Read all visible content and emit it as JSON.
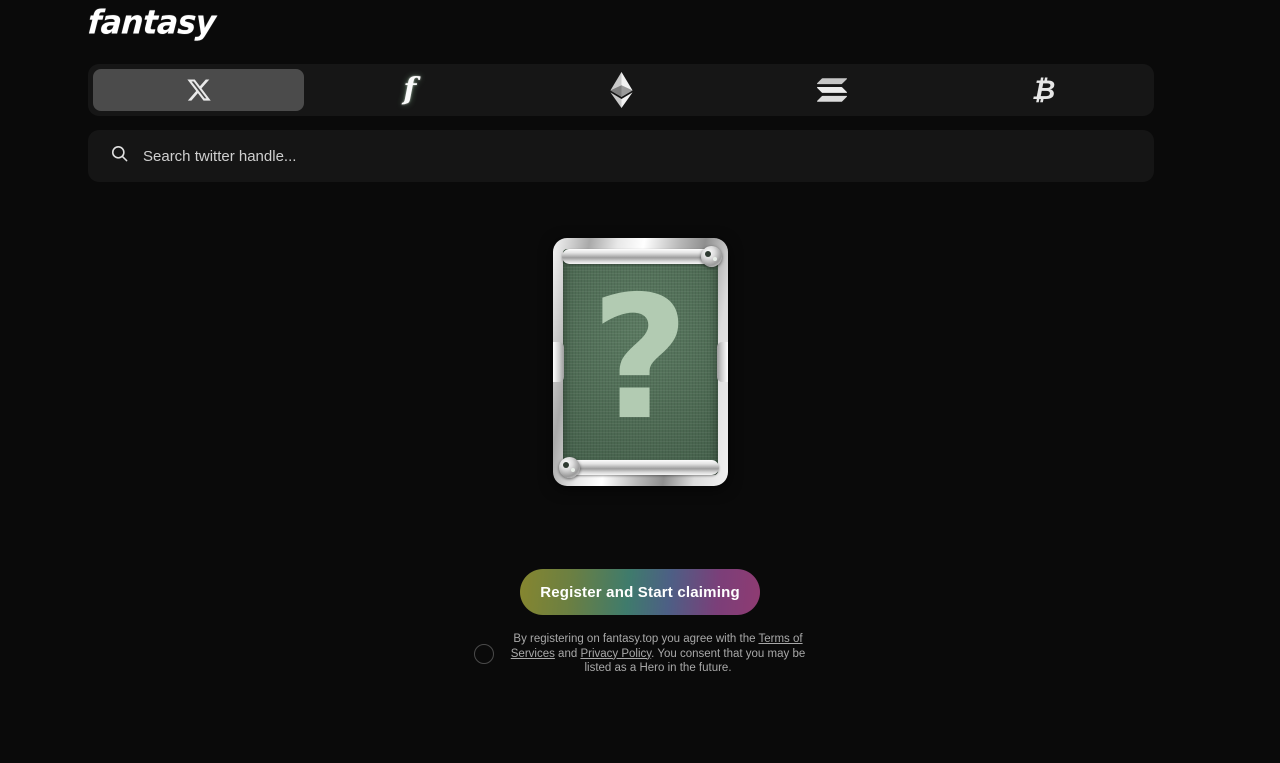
{
  "brand": {
    "logo_text": "fantasy"
  },
  "tabs": [
    {
      "id": "x",
      "icon": "x-twitter-icon",
      "label": "X",
      "active": true
    },
    {
      "id": "friend",
      "icon": "friendtech-icon",
      "label": "friend.tech",
      "active": false
    },
    {
      "id": "ethereum",
      "icon": "ethereum-icon",
      "label": "Ethereum",
      "active": false
    },
    {
      "id": "solana",
      "icon": "solana-icon",
      "label": "Solana",
      "active": false
    },
    {
      "id": "bitcoin",
      "icon": "bitcoin-icon",
      "label": "Bitcoin",
      "active": false
    }
  ],
  "search": {
    "icon": "search-icon",
    "placeholder": "Search twitter handle...",
    "value": ""
  },
  "card": {
    "icon": "question-mark-icon",
    "glyph": "?",
    "background_color": "#4e6b55",
    "glyph_color": "#b2cbb2",
    "frame_color": "#d8d8d8"
  },
  "cta": {
    "label": "Register and Start claiming",
    "gradient_start": "#86862f",
    "gradient_mid": "#3f7b6c",
    "gradient_end": "#8f3b72"
  },
  "consent": {
    "checked": false,
    "text_part1": "By registering on fantasy.top you agree with the ",
    "link_terms": "Terms of Services",
    "text_part2": " and ",
    "link_privacy": "Privacy Policy",
    "text_part3": ". You consent that you may be listed as a Hero in the future."
  },
  "theme": {
    "page_background": "#0a0a0a",
    "panel_background": "#161616",
    "active_tab_background": "#4b4b4b",
    "text_color": "#e3e3e3",
    "muted_text_color": "#a8a8a8"
  }
}
